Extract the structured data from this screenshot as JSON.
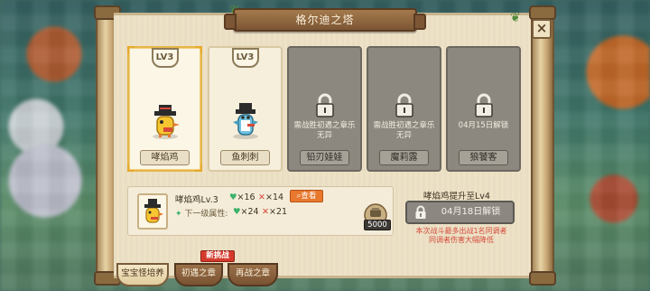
{
  "title": "格尔迪之塔",
  "close_icon": "×",
  "cards": [
    {
      "level": "LV3",
      "name": "哮焰鸡",
      "locked": false,
      "selected": true,
      "sprite": "chicken"
    },
    {
      "level": "LV3",
      "name": "鱼刺刺",
      "locked": false,
      "selected": false,
      "sprite": "penguin"
    },
    {
      "name": "铅刃娃娃",
      "locked": true,
      "lock_text": "需战胜初遇之章乐无异"
    },
    {
      "name": "魔莉露",
      "locked": true,
      "lock_text": "需战胜初遇之章乐无异"
    },
    {
      "name": "狼饕客",
      "locked": true,
      "lock_text": "04月15日解锁"
    }
  ],
  "info": {
    "name": "哮焰鸡Lv.3",
    "hp": "16",
    "atk": "14",
    "view_label": "查看",
    "next_label": "下一级属性:",
    "next_hp": "24",
    "next_atk": "21",
    "cost": "5000"
  },
  "upgrade": {
    "title": "哮焰鸡提升至Lv4",
    "button_label": "04月18日解锁",
    "warning_line1": "本次战斗最多出战1名同调者",
    "warning_line2": "同调者伤害大幅降低"
  },
  "tabs": [
    {
      "label": "宝宝怪培养",
      "active": true
    },
    {
      "label": "初遇之章",
      "active": false
    },
    {
      "label": "再战之章",
      "active": false
    }
  ],
  "new_badge": "新挑战",
  "colors": {
    "accent_orange": "#e8782e",
    "warning_red": "#d64a3a",
    "selected_gold": "#e6b64a",
    "heart_green": "#3bb06a"
  }
}
